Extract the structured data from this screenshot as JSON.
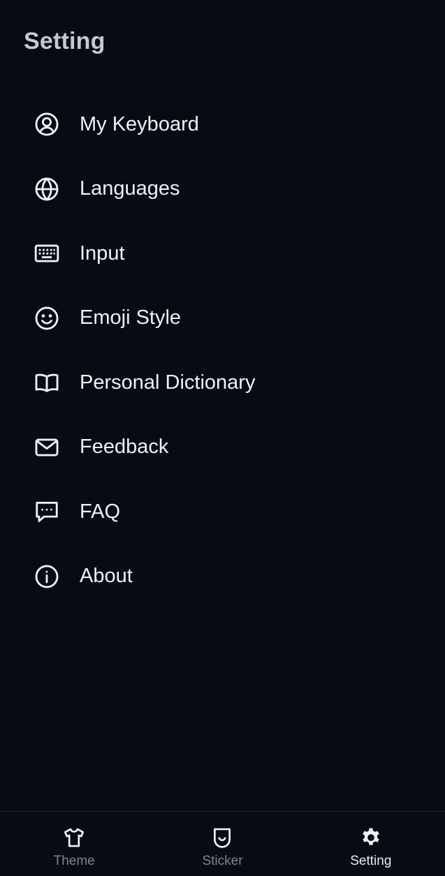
{
  "header": {
    "title": "Setting"
  },
  "colors": {
    "background": "#070b14",
    "text": "#eef0f5",
    "title": "#c7c9cf",
    "inactive_tab": "#80848c",
    "divider": "#1a1f2a"
  },
  "menu": {
    "items": [
      {
        "label": "My Keyboard",
        "icon": "user-circle-icon"
      },
      {
        "label": "Languages",
        "icon": "globe-icon"
      },
      {
        "label": "Input",
        "icon": "keyboard-icon"
      },
      {
        "label": "Emoji Style",
        "icon": "smiley-icon"
      },
      {
        "label": "Personal Dictionary",
        "icon": "book-icon"
      },
      {
        "label": "Feedback",
        "icon": "envelope-icon"
      },
      {
        "label": "FAQ",
        "icon": "chat-bubble-icon"
      },
      {
        "label": "About",
        "icon": "info-icon"
      }
    ]
  },
  "tabs": {
    "items": [
      {
        "label": "Theme",
        "icon": "t-shirt-icon",
        "active": false
      },
      {
        "label": "Sticker",
        "icon": "sticker-icon",
        "active": false
      },
      {
        "label": "Setting",
        "icon": "gear-icon",
        "active": true
      }
    ]
  }
}
